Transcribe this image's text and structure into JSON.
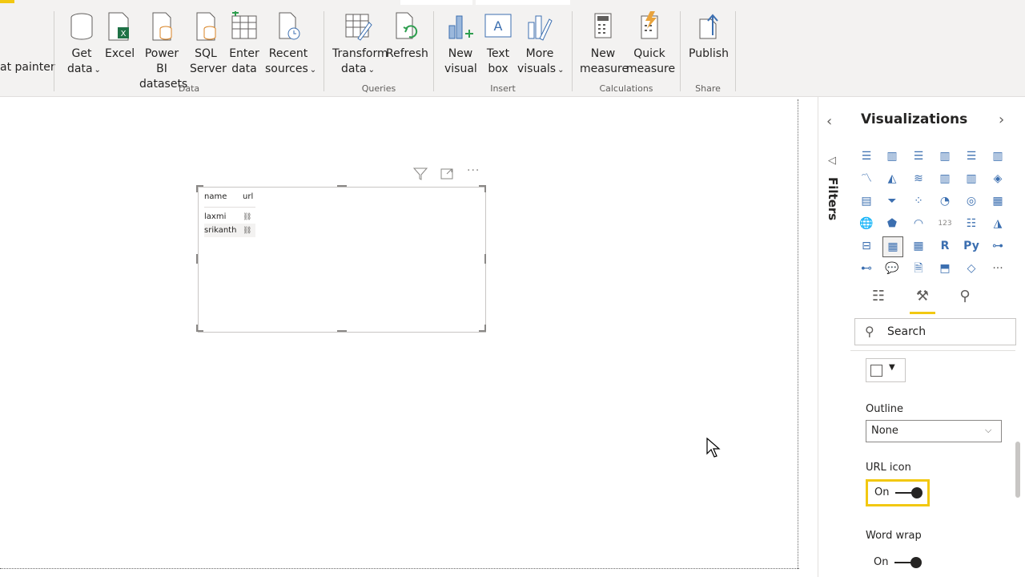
{
  "ribbon": {
    "format_painter": "at painter",
    "buttons": {
      "get_data": [
        "Get",
        "data"
      ],
      "excel": [
        "Excel"
      ],
      "pbi_datasets": [
        "Power BI",
        "datasets"
      ],
      "sql_server": [
        "SQL",
        "Server"
      ],
      "enter_data": [
        "Enter",
        "data"
      ],
      "recent_sources": [
        "Recent",
        "sources"
      ],
      "transform_data": [
        "Transform",
        "data"
      ],
      "refresh": [
        "Refresh"
      ],
      "new_visual": [
        "New",
        "visual"
      ],
      "text_box": [
        "Text",
        "box"
      ],
      "more_visuals": [
        "More",
        "visuals"
      ],
      "new_measure": [
        "New",
        "measure"
      ],
      "quick_measure": [
        "Quick",
        "measure"
      ],
      "publish": [
        "Publish"
      ]
    },
    "groups": {
      "data": "Data",
      "queries": "Queries",
      "insert": "Insert",
      "calculations": "Calculations",
      "share": "Share"
    },
    "accent_color": "#f2c811"
  },
  "table_visual": {
    "columns": [
      "name",
      "url"
    ],
    "rows": [
      {
        "name": "laxmi",
        "url_icon": "link-icon"
      },
      {
        "name": "srikanth",
        "url_icon": "link-icon"
      }
    ]
  },
  "filters": {
    "label": "Filters"
  },
  "visualizations": {
    "title": "Visualizations",
    "search_placeholder": "Search",
    "outline_label": "Outline",
    "outline_value": "None",
    "url_icon_label": "URL icon",
    "url_icon_toggle": "On",
    "word_wrap_label": "Word wrap",
    "word_wrap_toggle": "On",
    "icons": [
      "R",
      "Py",
      "123"
    ]
  }
}
